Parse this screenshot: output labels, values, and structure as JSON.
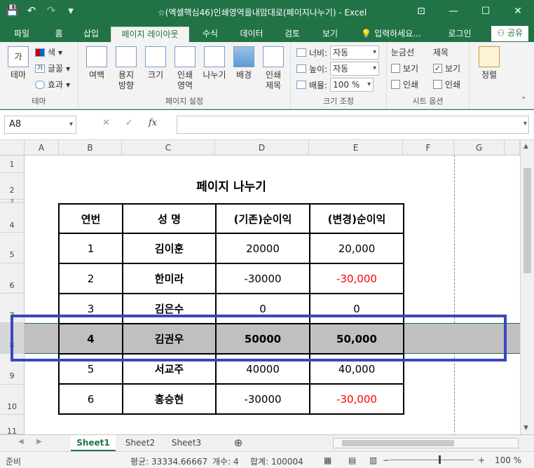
{
  "window": {
    "title": "☆(엑셀핵심46)인쇄영역을내맘대로(페이지나누기) - Excel",
    "qat": {
      "save_icon": "💾",
      "undo_icon": "↶",
      "redo_icon": "↷",
      "more_icon": "▾"
    },
    "controls": {
      "ribbon_icon": "⊡",
      "minimize": "—",
      "maximize": "☐",
      "close": "✕"
    }
  },
  "tabs": [
    "파일",
    "홈",
    "삽입",
    "페이지 레이아웃",
    "수식",
    "데이터",
    "검토",
    "보기"
  ],
  "tell_me": "입력하세요...",
  "login": "로그인",
  "share": "공유",
  "ribbon": {
    "theme_group": {
      "label": "테마",
      "theme": "테마",
      "colors": "색",
      "fonts": "글꼴",
      "effects": "효과"
    },
    "page_setup_group": {
      "label": "페이지 설정",
      "margins": "여백",
      "orientation": [
        "용지",
        "방향"
      ],
      "size": "크기",
      "print_area": [
        "인쇄",
        "영역"
      ],
      "breaks": "나누기",
      "background": "배경",
      "print_titles": [
        "인쇄",
        "제목"
      ]
    },
    "scale_group": {
      "label": "크기 조정",
      "width_label": "너비:",
      "width_value": "자동",
      "height_label": "높이:",
      "height_value": "자동",
      "scale_label": "배율:",
      "scale_value": "100 %"
    },
    "sheet_options_group": {
      "label": "시트 옵션",
      "gridlines": "눈금선",
      "headings": "제목",
      "view": "보기",
      "print": "인쇄"
    },
    "arrange_group": {
      "arrange": "정렬"
    }
  },
  "formula_bar": {
    "name_box": "A8",
    "cancel": "✕",
    "enter": "✓",
    "fx": "fx",
    "formula": ""
  },
  "columns": [
    "A",
    "B",
    "C",
    "D",
    "E",
    "F",
    "G"
  ],
  "rows": [
    "1",
    "2",
    "3",
    "4",
    "5",
    "6",
    "7",
    "8",
    "9",
    "10",
    "11"
  ],
  "sheet": {
    "title": "페이지  나누기",
    "headers": [
      "연번",
      "성    명",
      "(기존)순이익",
      "(변경)순이익"
    ],
    "data": [
      {
        "no": "1",
        "name": "김이훈",
        "old": "20000",
        "new": "20,000",
        "neg": false,
        "selected": false
      },
      {
        "no": "2",
        "name": "한미라",
        "old": "-30000",
        "new": "-30,000",
        "neg": true,
        "selected": false
      },
      {
        "no": "3",
        "name": "김은수",
        "old": "0",
        "new": "0",
        "neg": false,
        "selected": false
      },
      {
        "no": "4",
        "name": "김권우",
        "old": "50000",
        "new": "50,000",
        "neg": false,
        "selected": true
      },
      {
        "no": "5",
        "name": "서교주",
        "old": "40000",
        "new": "40,000",
        "neg": false,
        "selected": false
      },
      {
        "no": "6",
        "name": "홍승현",
        "old": "-30000",
        "new": "-30,000",
        "neg": true,
        "selected": false
      }
    ]
  },
  "sheet_tabs": [
    "Sheet1",
    "Sheet2",
    "Sheet3"
  ],
  "add_sheet": "⊕",
  "status": {
    "ready": "준비",
    "average": "평균: 33334.66667",
    "count": "개수: 4",
    "sum": "합계: 100004",
    "zoom": "100 %",
    "zoom_minus": "−",
    "zoom_plus": "+"
  }
}
